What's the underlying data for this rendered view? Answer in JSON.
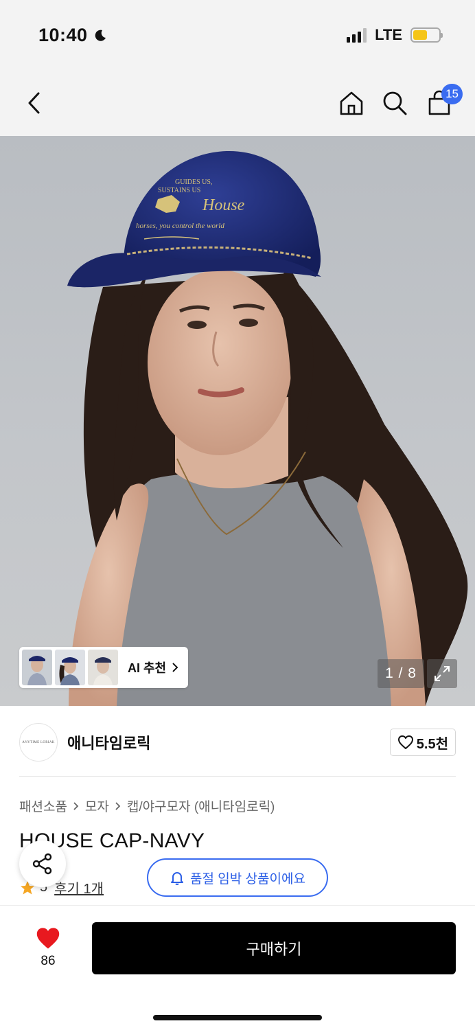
{
  "status_bar": {
    "time": "10:40",
    "network": "LTE",
    "battery_color": "#f5c518"
  },
  "nav": {
    "cart_count": "15",
    "back_icon": "chevron-left-icon",
    "home_icon": "home-icon",
    "search_icon": "search-icon",
    "cart_icon": "shopping-bag-icon"
  },
  "hero": {
    "ai_label": "AI 추천",
    "page_counter": "1 / 8",
    "cap_text_1": "GUIDES US,",
    "cap_text_2": "SUSTAINS US",
    "cap_text_3": "House",
    "cap_text_4": "horses, you control the world"
  },
  "brand": {
    "logo_text": "ANYTIME LORIAK",
    "name": "애니타임로릭",
    "likes": "5.5천"
  },
  "breadcrumb": [
    "패션소품",
    "모자",
    "캡/야구모자 (애니타임로릭)"
  ],
  "product": {
    "title": "HOUSE CAP-NAVY",
    "rating": "5",
    "reviews": "후기 1개"
  },
  "soldout_notice": "품절 임박 상품이에요",
  "bottom": {
    "wish_count": "86",
    "buy_label": "구매하기"
  },
  "colors": {
    "accent_blue": "#3a6cf0",
    "heart_red": "#e8191f",
    "star": "#f5a623"
  }
}
